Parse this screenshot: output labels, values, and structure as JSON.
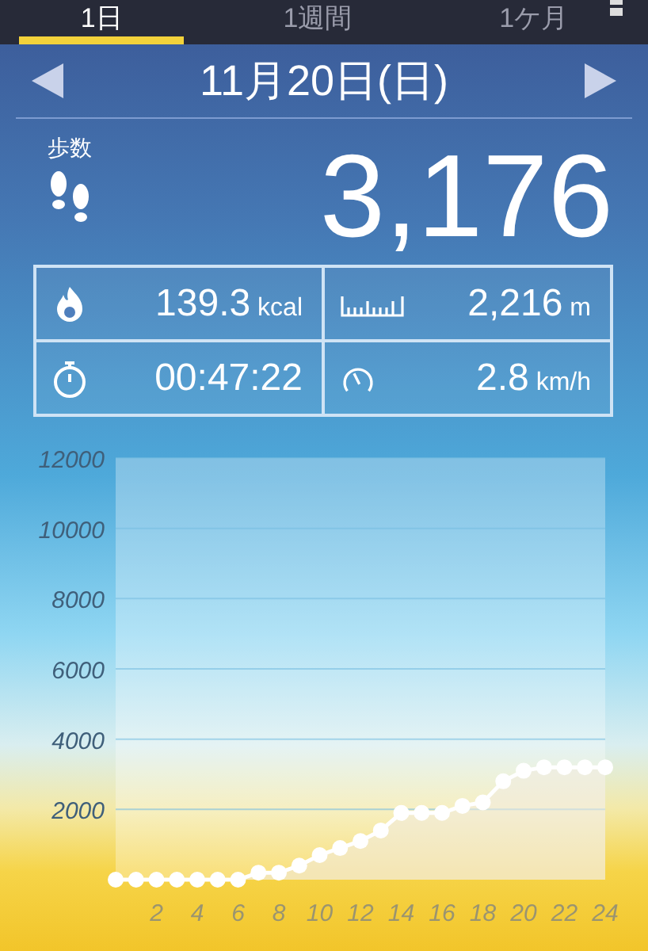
{
  "tabs": [
    {
      "label": "1日",
      "selected": true
    },
    {
      "label": "1週間",
      "selected": false
    },
    {
      "label": "1ケ月",
      "selected": false
    }
  ],
  "date": {
    "label": "11月20日(日)"
  },
  "steps": {
    "label": "歩数",
    "value": "3,176"
  },
  "stats": [
    {
      "kind": "calories",
      "value": "139.3",
      "unit": "kcal"
    },
    {
      "kind": "distance",
      "value": "2,216",
      "unit": "m"
    },
    {
      "kind": "time",
      "value": "00:47:22"
    },
    {
      "kind": "speed",
      "value": "2.8",
      "unit": "km/h"
    }
  ],
  "chart": {
    "chart_data": {
      "type": "line",
      "x": [
        0,
        1,
        2,
        3,
        4,
        5,
        6,
        7,
        8,
        9,
        10,
        11,
        12,
        13,
        14,
        15,
        16,
        17,
        18,
        19,
        20,
        21,
        22,
        23,
        24
      ],
      "series": [
        {
          "color": "#ffffff",
          "marker": true,
          "values": [
            0,
            0,
            0,
            0,
            0,
            0,
            0,
            200,
            200,
            400,
            700,
            900,
            1100,
            1400,
            1900,
            1900,
            1900,
            2100,
            2200,
            2800,
            3100,
            3200,
            3200,
            3200,
            3200
          ]
        }
      ],
      "grid": true,
      "xlim": [
        0,
        24
      ],
      "ylim": [
        0,
        12000
      ],
      "xticks": [
        2,
        4,
        6,
        8,
        10,
        12,
        14,
        16,
        18,
        20,
        22,
        24
      ],
      "yticks": [
        2000,
        4000,
        6000,
        8000,
        10000,
        12000
      ]
    }
  }
}
